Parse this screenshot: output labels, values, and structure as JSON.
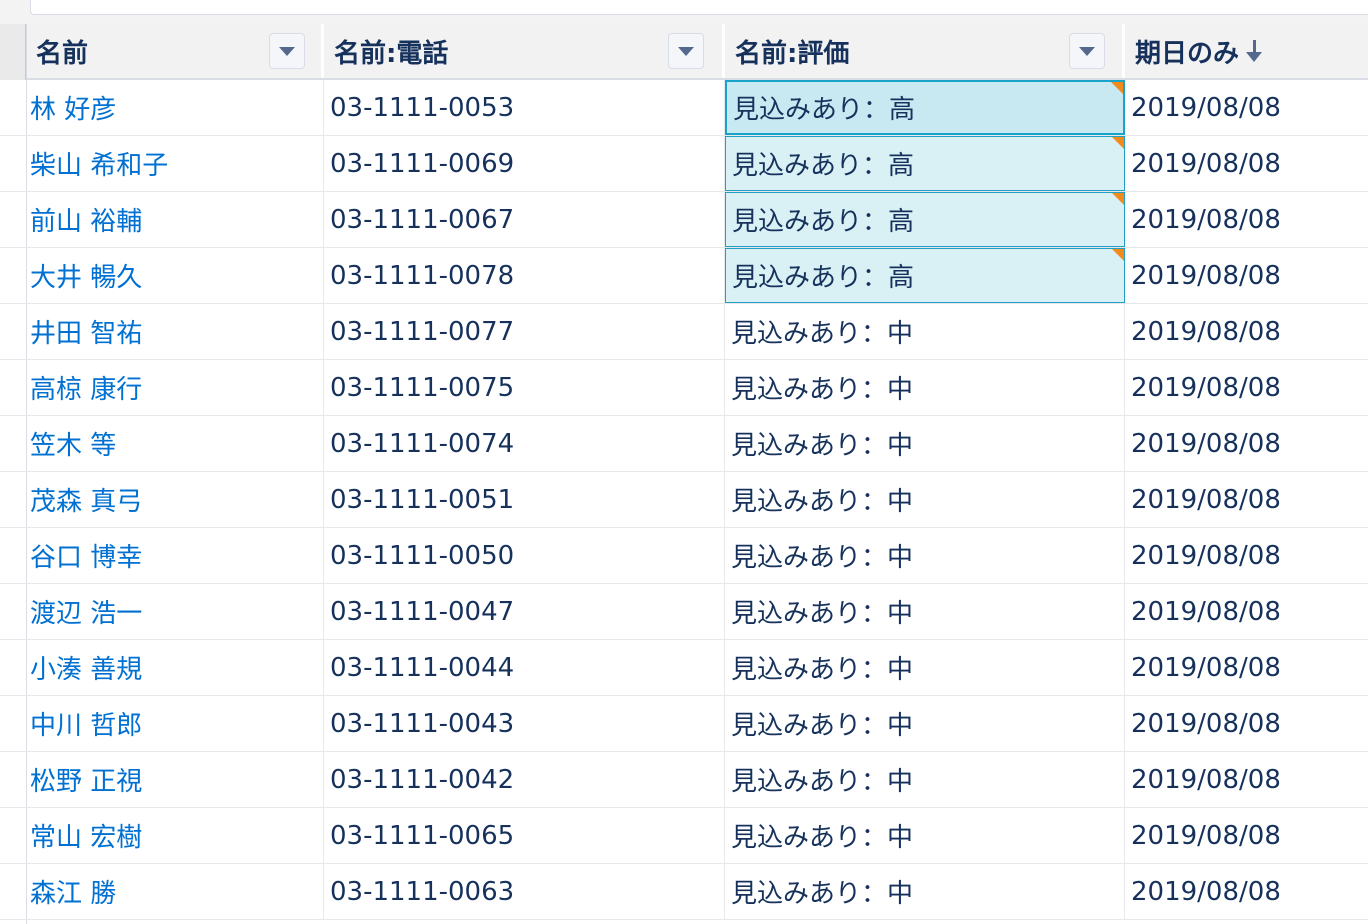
{
  "columns": {
    "name": "名前",
    "phone": "名前:電話",
    "rating": "名前:評価",
    "date": "期日のみ"
  },
  "colors": {
    "link": "#0070d2",
    "text": "#16325c",
    "selection_fill": "#d9f0f5",
    "selection_border": "#21a0c4",
    "changed_flag": "#f38a1c"
  },
  "rows": [
    {
      "name": "林 好彦",
      "phone": "03-1111-0053",
      "rating": "見込みあり：高",
      "date": "2019/08/08",
      "selected": true,
      "active": true
    },
    {
      "name": "柴山 希和子",
      "phone": "03-1111-0069",
      "rating": "見込みあり：高",
      "date": "2019/08/08",
      "selected": true
    },
    {
      "name": "前山 裕輔",
      "phone": "03-1111-0067",
      "rating": "見込みあり：高",
      "date": "2019/08/08",
      "selected": true
    },
    {
      "name": "大井 暢久",
      "phone": "03-1111-0078",
      "rating": "見込みあり：高",
      "date": "2019/08/08",
      "selected": true
    },
    {
      "name": "井田 智祐",
      "phone": "03-1111-0077",
      "rating": "見込みあり：中",
      "date": "2019/08/08"
    },
    {
      "name": "高椋 康行",
      "phone": "03-1111-0075",
      "rating": "見込みあり：中",
      "date": "2019/08/08"
    },
    {
      "name": "笠木 等",
      "phone": "03-1111-0074",
      "rating": "見込みあり：中",
      "date": "2019/08/08"
    },
    {
      "name": "茂森 真弓",
      "phone": "03-1111-0051",
      "rating": "見込みあり：中",
      "date": "2019/08/08"
    },
    {
      "name": "谷口 博幸",
      "phone": "03-1111-0050",
      "rating": "見込みあり：中",
      "date": "2019/08/08"
    },
    {
      "name": "渡辺 浩一",
      "phone": "03-1111-0047",
      "rating": "見込みあり：中",
      "date": "2019/08/08"
    },
    {
      "name": "小湊 善規",
      "phone": "03-1111-0044",
      "rating": "見込みあり：中",
      "date": "2019/08/08"
    },
    {
      "name": "中川 哲郎",
      "phone": "03-1111-0043",
      "rating": "見込みあり：中",
      "date": "2019/08/08"
    },
    {
      "name": "松野 正視",
      "phone": "03-1111-0042",
      "rating": "見込みあり：中",
      "date": "2019/08/08"
    },
    {
      "name": "常山 宏樹",
      "phone": "03-1111-0065",
      "rating": "見込みあり：中",
      "date": "2019/08/08"
    },
    {
      "name": "森江 勝",
      "phone": "03-1111-0063",
      "rating": "見込みあり：中",
      "date": "2019/08/08"
    }
  ]
}
